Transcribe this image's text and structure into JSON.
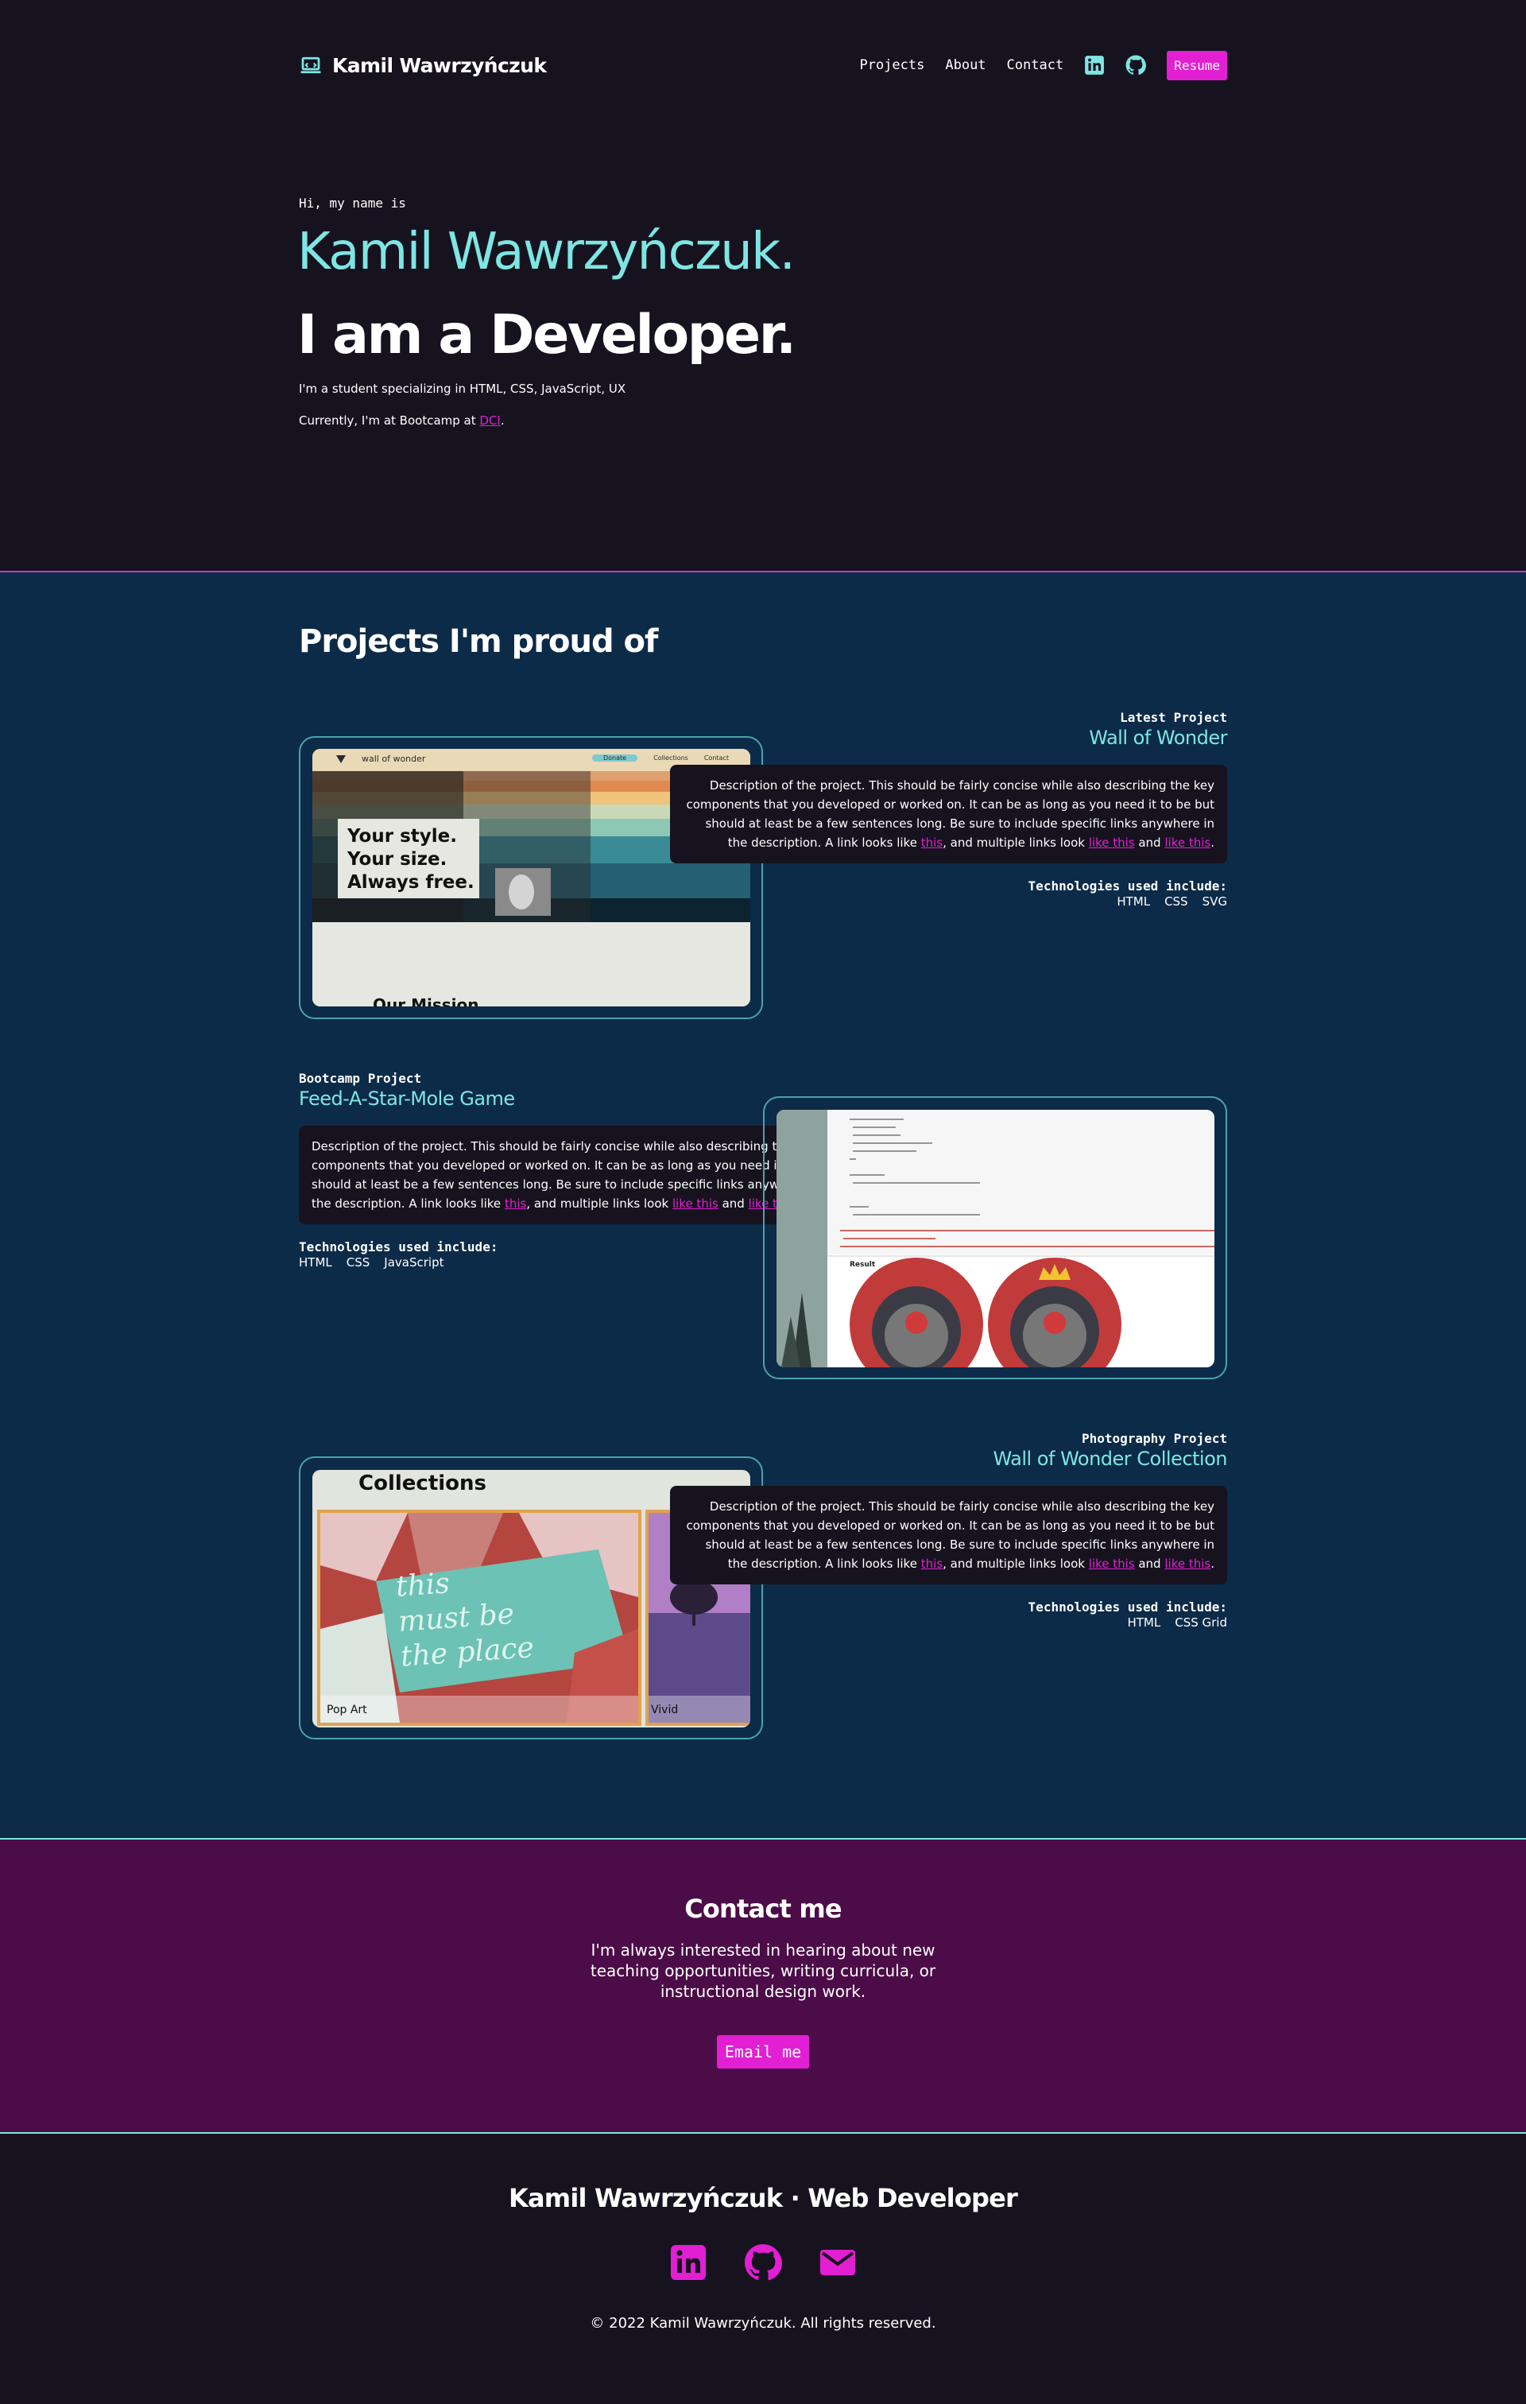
{
  "nav": {
    "logo": "Kamil Wawrzyńczuk",
    "links": [
      "Projects",
      "About",
      "Contact"
    ],
    "resume": "Resume"
  },
  "hero": {
    "intro": "Hi, my name is",
    "name": "Kamil Wawrzyńczuk.",
    "role": "I am a Developer.",
    "desc": "I'm a student specializing in HTML, CSS, JavaScript, UX",
    "current_prefix": "Currently, I'm at Bootcamp at ",
    "current_link": "DCI",
    "current_suffix": "."
  },
  "projects": {
    "title": "Projects I'm proud of",
    "tech_label": "Technologies used include:",
    "desc_text": {
      "before": "Description of the project. This should be fairly concise while also describing the key components that you developed or worked on. It can be as long as you need it to be but should at least be a few sentences long. Be sure to include specific links anywhere in the description. A link looks like ",
      "link1": "this",
      "middle": ", and multiple links look ",
      "link2": "like this",
      "and": " and ",
      "link3": "like this",
      "end": "."
    },
    "items": [
      {
        "label": "Latest Project",
        "title": "Wall of Wonder",
        "tech": [
          "HTML",
          "CSS",
          "SVG"
        ],
        "shot": {
          "brand": "wall of wonder",
          "menu": [
            "Donate",
            "Collections",
            "Contact"
          ],
          "headline": [
            "Your style.",
            "Your size.",
            "Always free."
          ],
          "section": "Our Mission"
        }
      },
      {
        "label": "Bootcamp Project",
        "title": "Feed-A-Star-Mole Game",
        "tech": [
          "HTML",
          "CSS",
          "JavaScript"
        ],
        "shot": {
          "result": "Result"
        }
      },
      {
        "label": "Photography Project",
        "title": "Wall of Wonder Collection",
        "tech": [
          "HTML",
          "CSS Grid"
        ],
        "shot": {
          "heading": "Collections",
          "neon": [
            "this",
            "must be",
            "the place"
          ],
          "card1": "Pop Art",
          "card2": "Vivid"
        }
      }
    ]
  },
  "contact": {
    "title": "Contact me",
    "text": "I'm always interested in hearing about new teaching opportunities, writing curricula, or instructional design work.",
    "button": "Email me"
  },
  "footer": {
    "title": "Kamil Wawrzyńczuk · Web Developer",
    "copyright": "© 2022 Kamil Wawrzyńczuk. All rights reserved."
  },
  "colors": {
    "background": "#16131f",
    "accent": "#e21fd3",
    "highlight": "#7ee6e2",
    "projects_bg": "#0c2b48",
    "contact_bg": "#4c0c48"
  },
  "icons": [
    "laptop-icon",
    "linkedin-icon",
    "github-icon",
    "mail-icon"
  ]
}
